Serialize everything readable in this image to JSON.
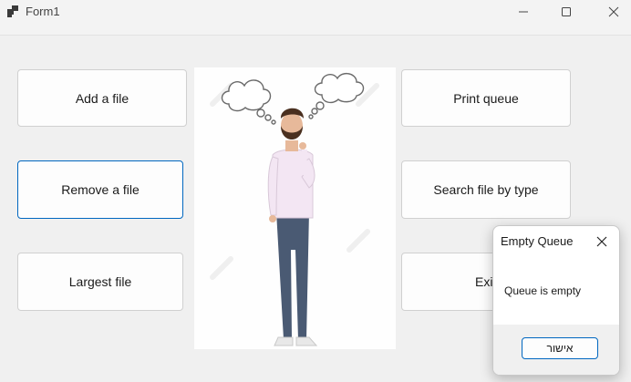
{
  "window": {
    "title": "Form1",
    "icons": {
      "app": "windows-form-icon",
      "minimize": "minimize-icon",
      "maximize": "maximize-icon",
      "close": "close-icon"
    }
  },
  "buttons": {
    "add_file": "Add a file",
    "remove_file": "Remove a file",
    "largest_file": "Largest file",
    "print_queue": "Print queue",
    "search_by_type": "Search file by type",
    "exit": "Exit"
  },
  "picture": {
    "subject": "thinking-man-illustration"
  },
  "dialog": {
    "title": "Empty Queue",
    "message": "Queue is empty",
    "ok_label": "אישור",
    "icons": {
      "close": "close-icon"
    }
  },
  "colors": {
    "accent": "#0067c0",
    "background": "#f0f0f0"
  }
}
